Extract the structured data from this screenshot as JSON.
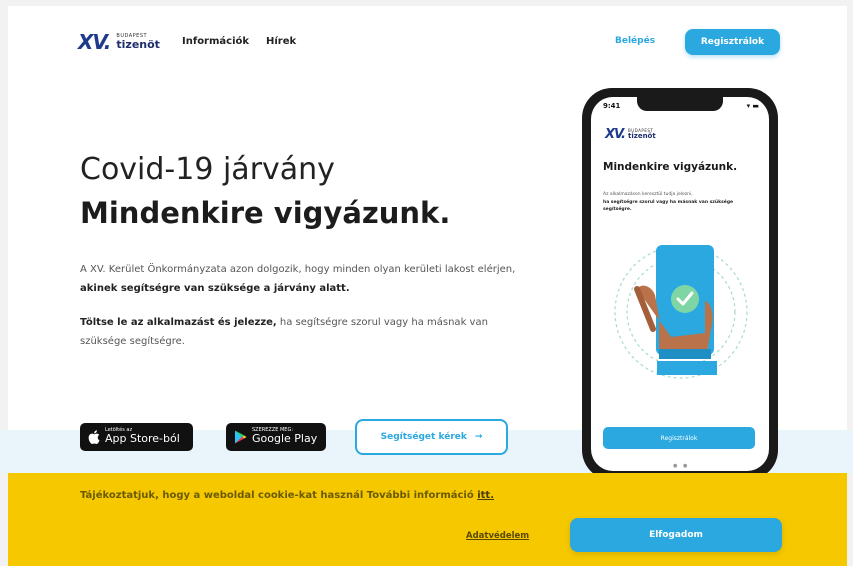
{
  "header": {
    "logo_small": "BUDAPEST",
    "logo_big": "tizenöt",
    "logo_mark": "XV.",
    "nav": [
      "Információk",
      "Hírek"
    ],
    "login": "Belépés",
    "register": "Regisztrálok"
  },
  "hero": {
    "title_1": "Covid-19 járvány",
    "title_2": "Mindenkire vigyázunk.",
    "p1_normal_1": "A XV. Kerület Önkormányzata azon dolgozik, hogy minden olyan kerületi lakost elérjen, ",
    "p1_bold": "akinek segítségre van szüksége a járvány alatt.",
    "p2_bold": "Töltse le az alkalmazást és jelezze,",
    "p2_normal": " ha segítségre szorul vagy ha másnak van szüksége segítségre."
  },
  "buttons": {
    "appstore_small": "Letöltés az",
    "appstore_big": "App Store-ból",
    "googleplay_small": "SZEREZZE MEG:",
    "googleplay_big": "Google Play",
    "help": "Segítséget kérek",
    "help_arrow": "→"
  },
  "phone": {
    "time": "9:41",
    "status": "▾ ▬",
    "logo_small": "BUDAPEST",
    "logo_big": "tizenöt",
    "logo_mark": "XV.",
    "title": "Mindenkire vigyázunk.",
    "text_normal": "Az alkalmazáson keresztül tudja jelezni,",
    "text_bold": "ha segítségre szorul vagy ha másnak van szüksége segítségre.",
    "register": "Regisztrálok",
    "dots": "● ●"
  },
  "cookie": {
    "text": "Tájékoztatjuk, hogy a weboldal cookie-kat használ További információ ",
    "link": "itt.",
    "privacy": "Adatvédelem",
    "accept": "Elfogadom"
  },
  "colors": {
    "accent": "#2aa8df",
    "cookie_bg": "#f5c800",
    "brand_dark": "#1e2d6b"
  }
}
